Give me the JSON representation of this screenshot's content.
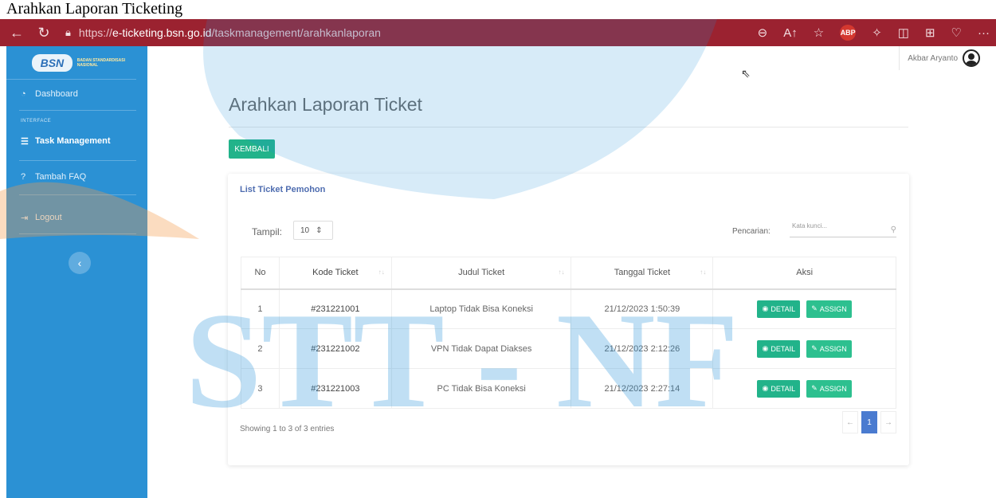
{
  "caption": "Arahkan Laporan Ticketing",
  "browser": {
    "url_scheme": "https://",
    "url_host": "e-ticketing.bsn.go.id",
    "url_path": "/taskmanagement/arahkanlaporan",
    "icons": [
      "back-icon",
      "refresh-icon",
      "lock-icon",
      "zoom-icon",
      "read-aloud-icon",
      "favorite-icon",
      "adblock-icon",
      "extensions-icon",
      "split-screen-icon",
      "collections-icon",
      "health-icon",
      "more-icon"
    ],
    "abp_label": "ABP",
    "more_label": "···"
  },
  "sidebar": {
    "logo_text": "BSN",
    "logo_subtitle": "BADAN STANDARDISASI NASIONAL",
    "items": [
      {
        "label": "Dashboard",
        "icon": "dashboard-icon"
      },
      {
        "label": "Task Management",
        "icon": "list-icon"
      },
      {
        "label": "Tambah FAQ",
        "icon": "question-icon"
      },
      {
        "label": "Logout",
        "icon": "logout-icon"
      }
    ],
    "section_heading": "INTERFACE",
    "collapse_icon": "‹"
  },
  "topbar": {
    "user_name": "Akbar Aryanto"
  },
  "page": {
    "title": "Arahkan Laporan Ticket",
    "back_button": "KEMBALI"
  },
  "card": {
    "title": "List Ticket Pemohon",
    "show_label": "Tampil:",
    "show_value": "10",
    "search_label": "Pencarian:",
    "search_placeholder": "Kata kunci...",
    "columns": [
      "No",
      "Kode Ticket",
      "Judul Ticket",
      "Tanggal Ticket",
      "Aksi"
    ],
    "rows": [
      {
        "no": "1",
        "code": "#231221001",
        "title": "Laptop Tidak Bisa Koneksi",
        "date": "21/12/2023 1:50:39"
      },
      {
        "no": "2",
        "code": "#231221002",
        "title": "VPN Tidak Dapat Diakses",
        "date": "21/12/2023 2:12:26"
      },
      {
        "no": "3",
        "code": "#231221003",
        "title": "PC Tidak Bisa Koneksi",
        "date": "21/12/2023 2:27:14"
      }
    ],
    "detail_label": "DETAIL",
    "assign_label": "ASSIGN",
    "info": "Showing 1 to 3 of 3 entries",
    "pager": {
      "prev": "←",
      "current": "1",
      "next": "→"
    }
  },
  "watermark": {
    "text": "STT - NF",
    "colors": {
      "blue": "#1f8fd8",
      "orange": "#f39a4a"
    }
  }
}
